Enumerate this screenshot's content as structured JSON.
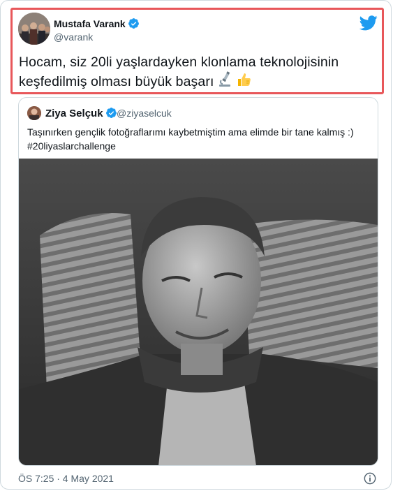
{
  "tweet": {
    "author_name": "Mustafa Varank",
    "author_handle": "@varank",
    "text": "Hocam, siz 20li yaşlardayken klonlama teknolojisinin keşfedilmiş olması büyük başarı",
    "emojis": [
      "microscope-emoji",
      "thumbs-up-emoji"
    ],
    "timestamp": "ÖS 7:25 · 4 May 2021"
  },
  "quoted_tweet": {
    "author_name": "Ziya Selçuk",
    "author_handle": "@ziyaselcuk",
    "text": "Taşınırken gençlik fotoğraflarımı kaybetmiştim ama elimde bir tane kalmış :) #20liyaslarchallenge"
  },
  "colors": {
    "twitter_blue": "#1d9bf0",
    "highlight_red": "#e8575a",
    "secondary_text": "#536471",
    "border": "#cfd9de"
  },
  "icons": [
    "twitter-bird-icon",
    "verified-badge-icon",
    "info-icon"
  ]
}
